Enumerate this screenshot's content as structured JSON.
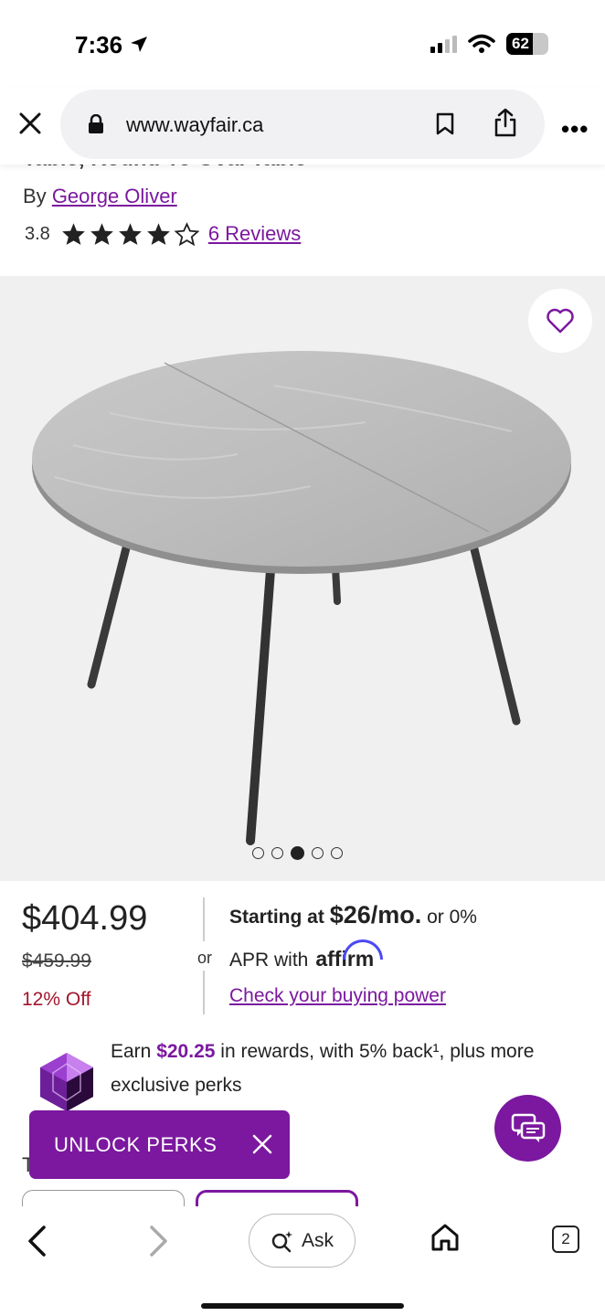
{
  "status_bar": {
    "time": "7:36",
    "battery": "62"
  },
  "browser": {
    "url": "www.wayfair.ca"
  },
  "product": {
    "title_partial": "Table, Round To Oval Table",
    "by_label": "By",
    "brand": "George Oliver",
    "rating": "3.8",
    "stars_filled": 4,
    "stars_total": 5,
    "reviews": "6 Reviews",
    "image_count": 5,
    "image_active_index": 2
  },
  "pricing": {
    "price": "$404.99",
    "old_price": "$459.99",
    "discount": "12% Off",
    "or": "or",
    "financing_prefix": "Starting at",
    "financing_amount": "$26/mo.",
    "financing_suffix": "or 0%",
    "apr_text": "APR with",
    "affirm_label": "affirm",
    "buying_power": "Check your buying power"
  },
  "rewards": {
    "earn": "Earn",
    "amount": "$20.25",
    "rest": "in rewards, with 5% back¹, plus more exclusive perks"
  },
  "unlock": {
    "label": "UNLOCK PERKS"
  },
  "partial_section": {
    "letter": "T"
  },
  "bottom_nav": {
    "ask": "Ask",
    "tabs": "2"
  },
  "colors": {
    "brand": "#7b189f",
    "discount": "#a3152c",
    "affirm": "#4a4af4"
  }
}
